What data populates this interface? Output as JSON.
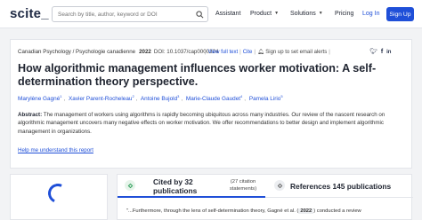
{
  "header": {
    "logo": "scite_",
    "search_placeholder": "Search by title, author, keyword or DOI",
    "nav": [
      "Assistant",
      "Product",
      "Solutions",
      "Pricing"
    ],
    "login": "Log In",
    "signup": "Sign Up",
    "accent": "#1f4fd8"
  },
  "paper": {
    "journal": "Canadian Psychology / Psychologie canadienne",
    "year": "2022",
    "doi": "DOI: 10.1037/cap0000324",
    "view_full_text": "View full text",
    "cite": "Cite",
    "alert": "Sign up to set email alerts",
    "title": "How algorithmic management influences worker motivation: A self-determination theory perspective.",
    "authors": [
      {
        "name": "Marylène Gagné",
        "sup": "1"
      },
      {
        "name": "Xavier Parent-Rocheleau",
        "sup": "2"
      },
      {
        "name": "Antoine Bujold",
        "sup": "3"
      },
      {
        "name": "Marie-Claude Gaudet",
        "sup": "4"
      },
      {
        "name": "Pamela Lirio",
        "sup": "5"
      }
    ],
    "abstract_label": "Abstract:",
    "abstract": "The management of workers using algorithms is rapidly becoming ubiquitous across many industries. Our review of the nascent research on algorithmic management uncovers many negative effects on worker motivation. We offer recommendations to better design and implement algorithmic management in organizations.",
    "help_link": "Help me understand this report"
  },
  "citations": {
    "cited_by": "Cited by 32 publications",
    "statements": "(27 citation statements)",
    "references": "References 145 publications",
    "snippet_pre": "\"...Furthermore, through the lens of self-determination theory, Gagné et al. (",
    "snippet_year": "2022",
    "snippet_post": ") conducted a review"
  }
}
